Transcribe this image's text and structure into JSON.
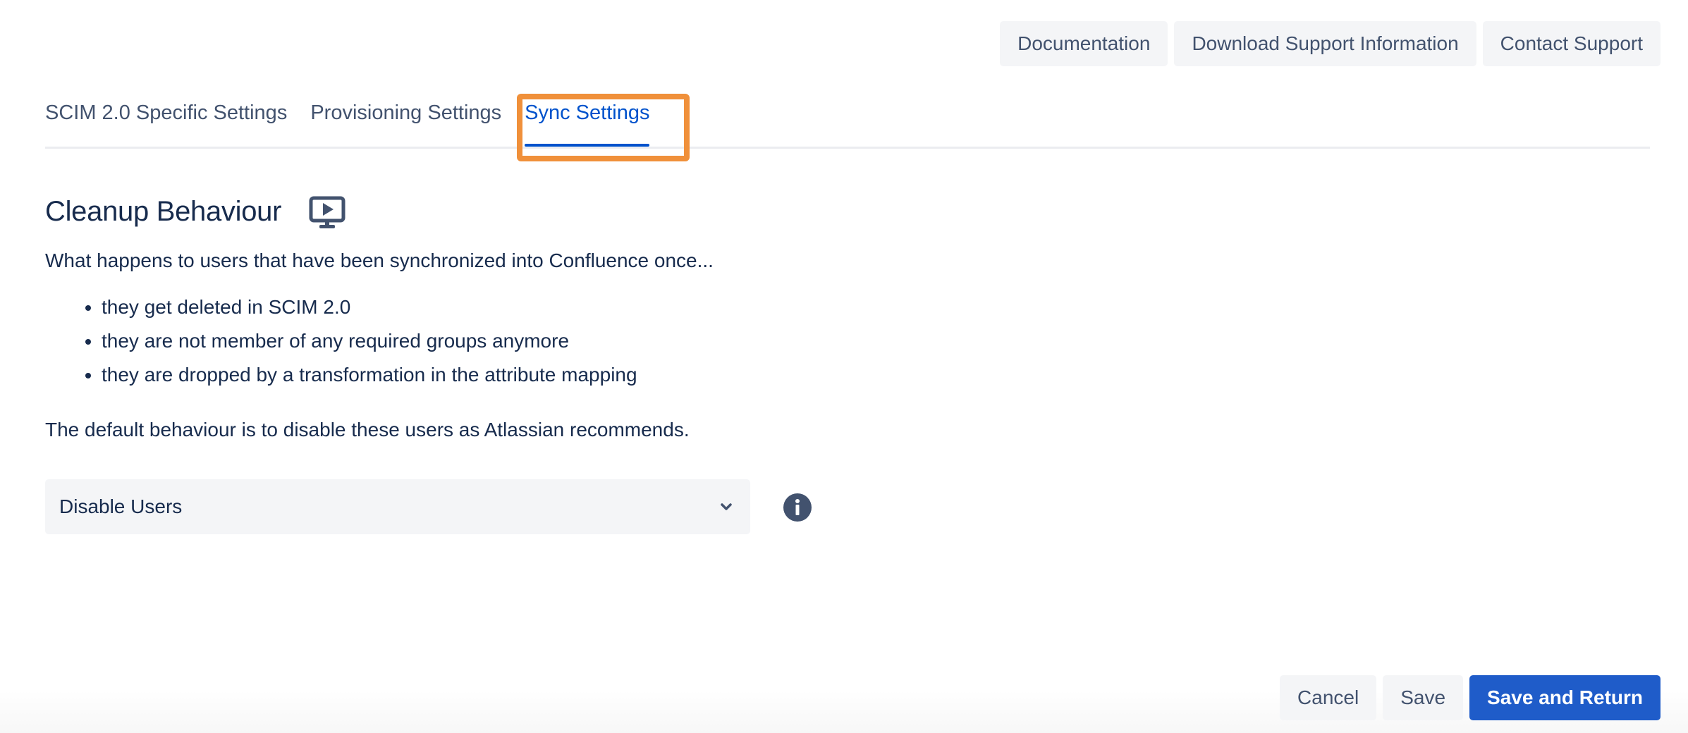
{
  "top_actions": {
    "documentation": "Documentation",
    "download_support": "Download Support Information",
    "contact_support": "Contact Support"
  },
  "tabs": [
    {
      "label": "SCIM 2.0 Specific Settings",
      "active": false
    },
    {
      "label": "Provisioning Settings",
      "active": false
    },
    {
      "label": "Sync Settings",
      "active": true
    }
  ],
  "section": {
    "title": "Cleanup Behaviour",
    "intro": "What happens to users that have been synchronized into Confluence once...",
    "bullets": [
      "they get deleted in SCIM 2.0",
      "they are not member of any required groups anymore",
      "they are dropped by a transformation in the attribute mapping"
    ],
    "default_note": "The default behaviour is to disable these users as Atlassian recommends."
  },
  "select": {
    "value": "Disable Users"
  },
  "icons": {
    "video": "video-tutorial-icon",
    "info": "info-icon",
    "chevron": "chevron-down-icon"
  },
  "bottom_actions": {
    "cancel": "Cancel",
    "save": "Save",
    "save_and_return": "Save and Return"
  },
  "colors": {
    "primary": "#1f5cc9",
    "tab_active": "#0052cc",
    "highlight": "#f0903a",
    "text": "#172b4d",
    "muted": "#42526e",
    "button_bg": "#f4f5f7"
  }
}
